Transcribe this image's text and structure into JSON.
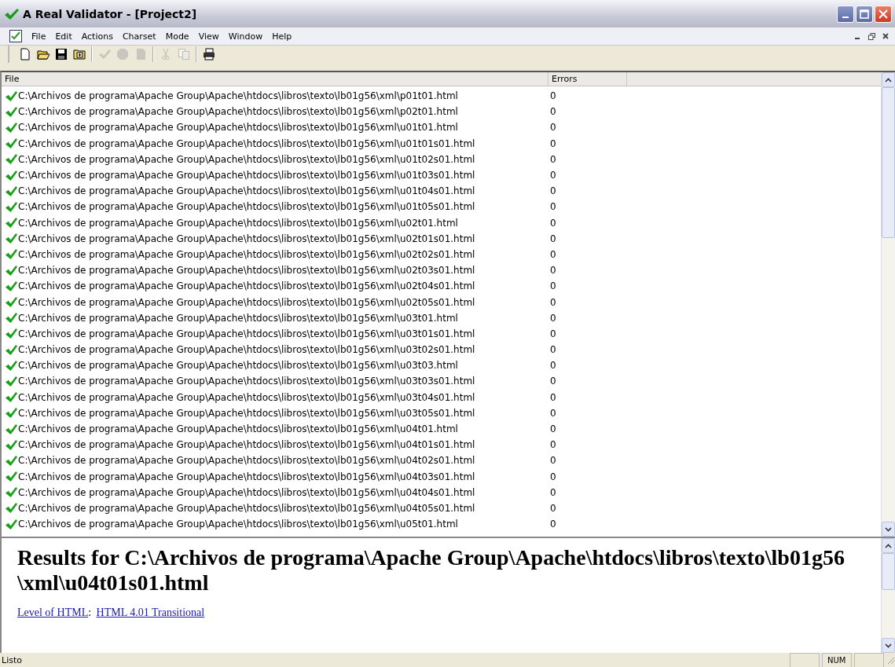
{
  "window": {
    "title": "A Real Validator - [Project2]"
  },
  "menu": [
    "File",
    "Edit",
    "Actions",
    "Charset",
    "Mode",
    "View",
    "Window",
    "Help"
  ],
  "toolbar": [
    {
      "kind": "new",
      "disabled": false
    },
    {
      "kind": "open",
      "disabled": false
    },
    {
      "kind": "save",
      "disabled": false
    },
    {
      "kind": "add",
      "disabled": false
    },
    {
      "kind": "sep"
    },
    {
      "kind": "validate",
      "disabled": true
    },
    {
      "kind": "stop",
      "disabled": true
    },
    {
      "kind": "page",
      "disabled": true
    },
    {
      "kind": "sep"
    },
    {
      "kind": "cut",
      "disabled": true
    },
    {
      "kind": "copy",
      "disabled": true
    },
    {
      "kind": "sep"
    },
    {
      "kind": "print",
      "disabled": false
    }
  ],
  "table": {
    "columns": [
      "File",
      "Errors"
    ],
    "rows": [
      {
        "file": "C:\\Archivos de programa\\Apache Group\\Apache\\htdocs\\libros\\texto\\lb01g56\\xml\\p01t01.html",
        "errors": "0",
        "valid": true
      },
      {
        "file": "C:\\Archivos de programa\\Apache Group\\Apache\\htdocs\\libros\\texto\\lb01g56\\xml\\p02t01.html",
        "errors": "0",
        "valid": true
      },
      {
        "file": "C:\\Archivos de programa\\Apache Group\\Apache\\htdocs\\libros\\texto\\lb01g56\\xml\\u01t01.html",
        "errors": "0",
        "valid": true
      },
      {
        "file": "C:\\Archivos de programa\\Apache Group\\Apache\\htdocs\\libros\\texto\\lb01g56\\xml\\u01t01s01.html",
        "errors": "0",
        "valid": true
      },
      {
        "file": "C:\\Archivos de programa\\Apache Group\\Apache\\htdocs\\libros\\texto\\lb01g56\\xml\\u01t02s01.html",
        "errors": "0",
        "valid": true
      },
      {
        "file": "C:\\Archivos de programa\\Apache Group\\Apache\\htdocs\\libros\\texto\\lb01g56\\xml\\u01t03s01.html",
        "errors": "0",
        "valid": true
      },
      {
        "file": "C:\\Archivos de programa\\Apache Group\\Apache\\htdocs\\libros\\texto\\lb01g56\\xml\\u01t04s01.html",
        "errors": "0",
        "valid": true
      },
      {
        "file": "C:\\Archivos de programa\\Apache Group\\Apache\\htdocs\\libros\\texto\\lb01g56\\xml\\u01t05s01.html",
        "errors": "0",
        "valid": true
      },
      {
        "file": "C:\\Archivos de programa\\Apache Group\\Apache\\htdocs\\libros\\texto\\lb01g56\\xml\\u02t01.html",
        "errors": "0",
        "valid": true
      },
      {
        "file": "C:\\Archivos de programa\\Apache Group\\Apache\\htdocs\\libros\\texto\\lb01g56\\xml\\u02t01s01.html",
        "errors": "0",
        "valid": true
      },
      {
        "file": "C:\\Archivos de programa\\Apache Group\\Apache\\htdocs\\libros\\texto\\lb01g56\\xml\\u02t02s01.html",
        "errors": "0",
        "valid": true
      },
      {
        "file": "C:\\Archivos de programa\\Apache Group\\Apache\\htdocs\\libros\\texto\\lb01g56\\xml\\u02t03s01.html",
        "errors": "0",
        "valid": true
      },
      {
        "file": "C:\\Archivos de programa\\Apache Group\\Apache\\htdocs\\libros\\texto\\lb01g56\\xml\\u02t04s01.html",
        "errors": "0",
        "valid": true
      },
      {
        "file": "C:\\Archivos de programa\\Apache Group\\Apache\\htdocs\\libros\\texto\\lb01g56\\xml\\u02t05s01.html",
        "errors": "0",
        "valid": true
      },
      {
        "file": "C:\\Archivos de programa\\Apache Group\\Apache\\htdocs\\libros\\texto\\lb01g56\\xml\\u03t01.html",
        "errors": "0",
        "valid": true
      },
      {
        "file": "C:\\Archivos de programa\\Apache Group\\Apache\\htdocs\\libros\\texto\\lb01g56\\xml\\u03t01s01.html",
        "errors": "0",
        "valid": true
      },
      {
        "file": "C:\\Archivos de programa\\Apache Group\\Apache\\htdocs\\libros\\texto\\lb01g56\\xml\\u03t02s01.html",
        "errors": "0",
        "valid": true
      },
      {
        "file": "C:\\Archivos de programa\\Apache Group\\Apache\\htdocs\\libros\\texto\\lb01g56\\xml\\u03t03.html",
        "errors": "0",
        "valid": true
      },
      {
        "file": "C:\\Archivos de programa\\Apache Group\\Apache\\htdocs\\libros\\texto\\lb01g56\\xml\\u03t03s01.html",
        "errors": "0",
        "valid": true
      },
      {
        "file": "C:\\Archivos de programa\\Apache Group\\Apache\\htdocs\\libros\\texto\\lb01g56\\xml\\u03t04s01.html",
        "errors": "0",
        "valid": true
      },
      {
        "file": "C:\\Archivos de programa\\Apache Group\\Apache\\htdocs\\libros\\texto\\lb01g56\\xml\\u03t05s01.html",
        "errors": "0",
        "valid": true
      },
      {
        "file": "C:\\Archivos de programa\\Apache Group\\Apache\\htdocs\\libros\\texto\\lb01g56\\xml\\u04t01.html",
        "errors": "0",
        "valid": true
      },
      {
        "file": "C:\\Archivos de programa\\Apache Group\\Apache\\htdocs\\libros\\texto\\lb01g56\\xml\\u04t01s01.html",
        "errors": "0",
        "valid": true
      },
      {
        "file": "C:\\Archivos de programa\\Apache Group\\Apache\\htdocs\\libros\\texto\\lb01g56\\xml\\u04t02s01.html",
        "errors": "0",
        "valid": true
      },
      {
        "file": "C:\\Archivos de programa\\Apache Group\\Apache\\htdocs\\libros\\texto\\lb01g56\\xml\\u04t03s01.html",
        "errors": "0",
        "valid": true
      },
      {
        "file": "C:\\Archivos de programa\\Apache Group\\Apache\\htdocs\\libros\\texto\\lb01g56\\xml\\u04t04s01.html",
        "errors": "0",
        "valid": true
      },
      {
        "file": "C:\\Archivos de programa\\Apache Group\\Apache\\htdocs\\libros\\texto\\lb01g56\\xml\\u04t05s01.html",
        "errors": "0",
        "valid": true
      },
      {
        "file": "C:\\Archivos de programa\\Apache Group\\Apache\\htdocs\\libros\\texto\\lb01g56\\xml\\u05t01.html",
        "errors": "0",
        "valid": true
      }
    ]
  },
  "results": {
    "heading": "Results for C:\\Archivos de programa\\Apache Group\\Apache\\htdocs\\libros\\texto\\lb01g56\\xml\\u04t01s01.html",
    "level_label": "Level of HTML",
    "separator": ":",
    "level_value": "HTML 4.01 Transitional"
  },
  "status_bar": {
    "text": "Listo",
    "indicator": "NUM"
  }
}
